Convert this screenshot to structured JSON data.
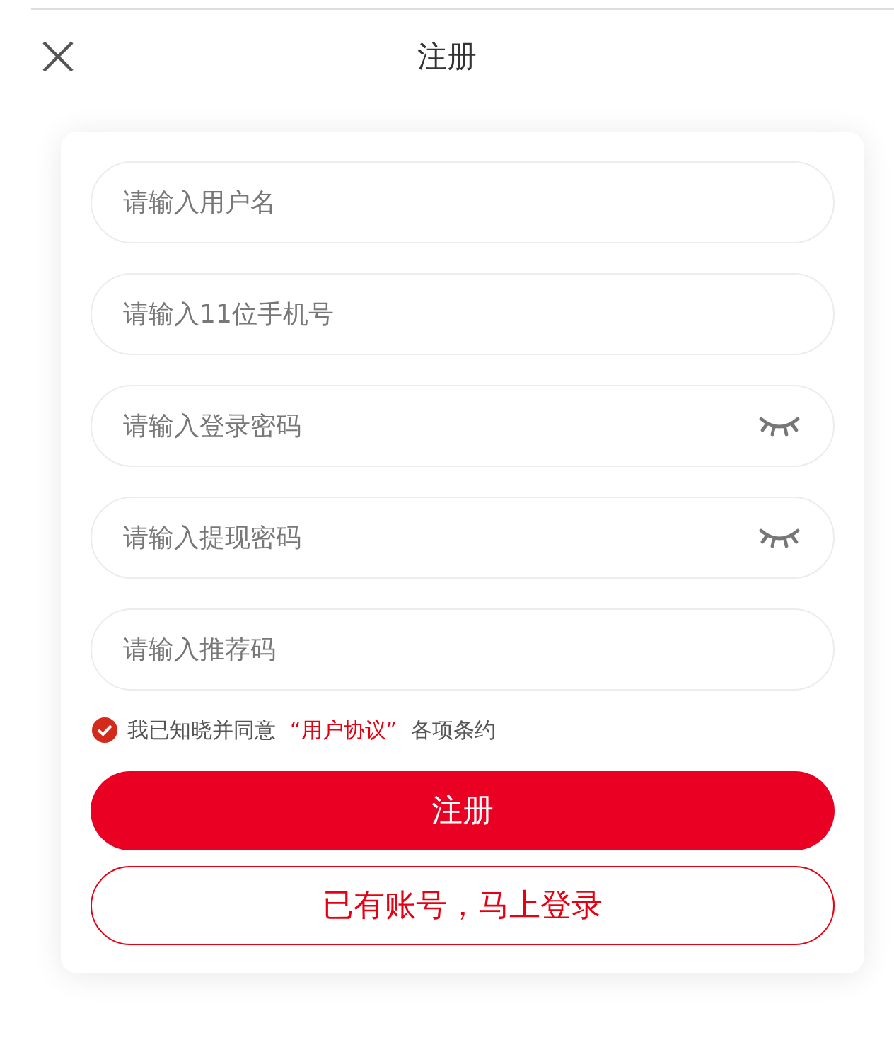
{
  "header": {
    "title": "注册"
  },
  "fields": [
    {
      "placeholder": "请输入用户名",
      "kind": "text"
    },
    {
      "placeholder": "请输入11位手机号",
      "kind": "text"
    },
    {
      "placeholder": "请输入登录密码",
      "kind": "password"
    },
    {
      "placeholder": "请输入提现密码",
      "kind": "password"
    },
    {
      "placeholder": "请输入推荐码",
      "kind": "text"
    }
  ],
  "agreement": {
    "checked": true,
    "before": "我已知晓并同意",
    "link": "“用户协议”",
    "after": "各项条约"
  },
  "buttons": [
    {
      "label": "注册",
      "kind": "primary"
    },
    {
      "label": "已有账号，马上登录",
      "kind": "outline"
    }
  ]
}
